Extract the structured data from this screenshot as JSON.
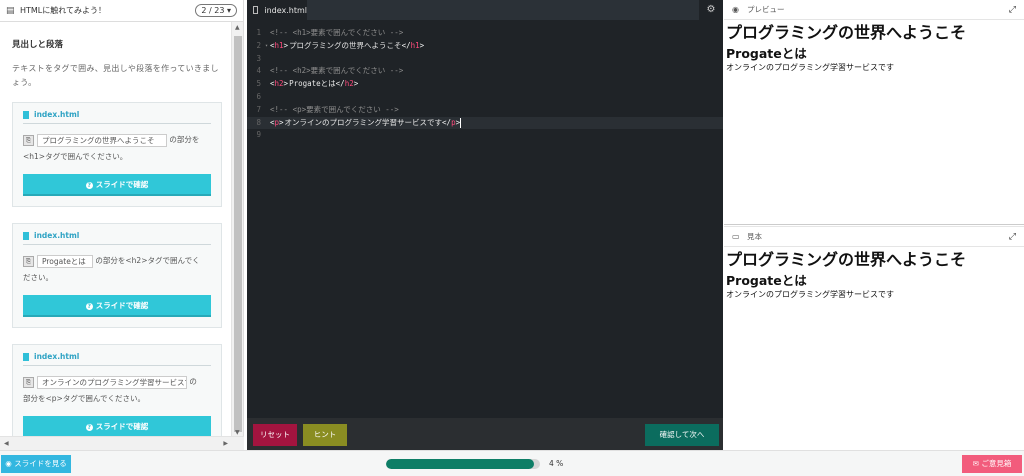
{
  "left": {
    "title": "HTMLに触れてみよう！",
    "pager": "2 / 23",
    "section_title": "見出しと段落",
    "section_text": "テキストをタグで囲み、見出しや段落を作っていきましょう。",
    "tasks": [
      {
        "file": "index.html",
        "input": "プログラミングの世界へようこそ",
        "line1_after": "の部分を",
        "line2": "<h1>タグで囲んでください。",
        "button": "スライドで確認"
      },
      {
        "file": "index.html",
        "input": "Progateとは",
        "line1_after": "の部分を<h2>タグで囲んでく",
        "line2": "ださい。",
        "button": "スライドで確認"
      },
      {
        "file": "index.html",
        "input": "オンラインのプログラミング学習サービスです",
        "line1_after": "の",
        "line2": "部分を<p>タグで囲んでください。",
        "button": "スライドで確認"
      }
    ]
  },
  "editor": {
    "tab": "index.html",
    "lines": [
      {
        "n": "1",
        "fold": "",
        "comment": "<!-- <h1>要素で囲んでください -->"
      },
      {
        "n": "2",
        "fold": "▾",
        "open": "h1",
        "text": "プログラミングの世界へようこそ",
        "close": "h1"
      },
      {
        "n": "3"
      },
      {
        "n": "4",
        "fold": "",
        "comment": "<!-- <h2>要素で囲んでください -->"
      },
      {
        "n": "5",
        "fold": "",
        "open": "h2",
        "text": "Progateとは",
        "close": "h2"
      },
      {
        "n": "6"
      },
      {
        "n": "7",
        "fold": "",
        "comment": "<!-- <p>要素で囲んでください -->"
      },
      {
        "n": "8",
        "fold": "",
        "open": "p",
        "text": "オンラインのプログラミング学習サービスです",
        "close": "p",
        "active": true
      },
      {
        "n": "9"
      }
    ],
    "reset": "リセット",
    "hint": "ヒント",
    "next": "確認して次へ"
  },
  "preview": {
    "label": "プレビュー",
    "h1": "プログラミングの世界へようこそ",
    "h2": "Progateとは",
    "p": "オンラインのプログラミング学習サービスです"
  },
  "sample": {
    "label": "見本",
    "h1": "プログラミングの世界へようこそ",
    "h2": "Progateとは",
    "p": "オンラインのプログラミング学習サービスです"
  },
  "bottom": {
    "slide_button": "スライドを見る",
    "progress_label": "4 %",
    "progress_value": 0.96,
    "opinion_button": "ご意見箱"
  },
  "colors": {
    "accent": "#30c7d8",
    "editor_bg": "#1f2327",
    "reset": "#a3143f",
    "hint": "#8a8d22",
    "next": "#0b6c5e",
    "progress": "#0e7e66",
    "opinion": "#f25c7c",
    "slide_btn": "#33b7e0"
  }
}
